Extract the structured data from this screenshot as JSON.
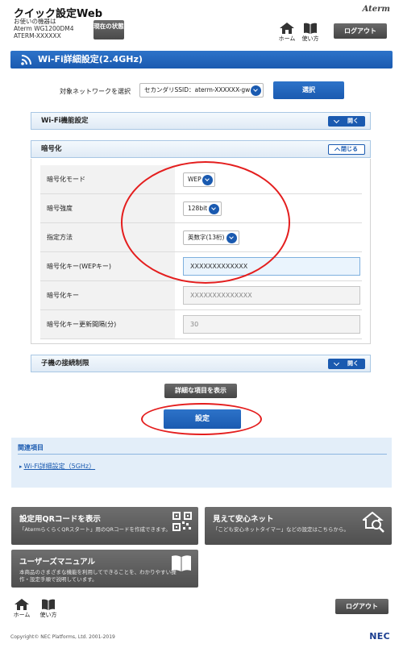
{
  "header": {
    "app_title": "クイック設定Web",
    "device_caption": "お使いの機器は",
    "device_model": "Aterm WG1200DM4",
    "device_name": "ATERM-XXXXXX",
    "status_button": "現在の状態",
    "brand": "Aterm",
    "home_label": "ホーム",
    "help_label": "使い方",
    "logout_label": "ログアウト"
  },
  "page_title": "Wi-Fi詳細設定(2.4GHz)",
  "network": {
    "label": "対象ネットワークを選択",
    "selected": "セカンダリSSID：aterm-XXXXXX-gw",
    "select_button": "選択"
  },
  "sections": {
    "wifi_function": {
      "label": "Wi-Fi機能設定",
      "button": "開く"
    },
    "encryption": {
      "label": "暗号化",
      "button": "閉じる"
    },
    "connection_limit": {
      "label": "子機の接続制限",
      "button": "開く"
    }
  },
  "encryption_rows": {
    "mode": {
      "label": "暗号化モード",
      "value": "WEP"
    },
    "strength": {
      "label": "暗号強度",
      "value": "128bit"
    },
    "method": {
      "label": "指定方法",
      "value": "英数字(13桁)"
    },
    "wep_key": {
      "label": "暗号化キー(WEPキー)",
      "value": "XXXXXXXXXXXXX"
    },
    "key": {
      "label": "暗号化キー",
      "value": "XXXXXXXXXXXXXX"
    },
    "interval": {
      "label": "暗号化キー更新間隔(分)",
      "value": "30"
    }
  },
  "detail_button": "詳細な項目を表示",
  "set_button": "設定",
  "related": {
    "heading": "関連項目",
    "link": "Wi-Fi詳細設定（5GHz）"
  },
  "tiles": {
    "qr": {
      "title": "設定用QRコードを表示",
      "desc": "「AtermらくらくQRスタート」用のQRコードを作成できます。"
    },
    "safety": {
      "title": "見えて安心ネット",
      "desc": "「こども安心ネットタイマー」などの設定はこちらから。"
    },
    "manual": {
      "title": "ユーザーズマニュアル",
      "desc": "本商品のさまざまな機能を利用してできることを、わかりやすい操作・設定手順で説明しています。"
    }
  },
  "footer": {
    "copyright": "Copyright© NEC Platforms, Ltd. 2001-2019",
    "brand": "NEC"
  },
  "colors": {
    "accent": "#1a5ab0",
    "highlight": "#e41e1e",
    "tile": "#5a5a5a"
  }
}
